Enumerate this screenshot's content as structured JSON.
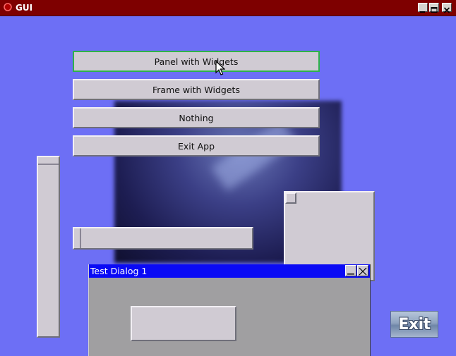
{
  "window": {
    "title": "GUI",
    "controls": [
      "minimize-icon",
      "maximize-icon",
      "close-icon"
    ]
  },
  "buttons": {
    "panel_with_widgets": "Panel with Widgets",
    "frame_with_widgets": "Frame with Widgets",
    "nothing": "Nothing",
    "exit_app": "Exit App"
  },
  "dialog": {
    "title": "Test Dialog 1",
    "controls": [
      "minimize-icon",
      "close-icon"
    ]
  },
  "exit_image": {
    "label": "Exit"
  },
  "colors": {
    "background": "#6d6ff5",
    "titlebar": "#7e0000",
    "dialog_titlebar": "#0a0af5",
    "widget_face": "#d0cbd3",
    "focus_outline": "#2fb24a"
  }
}
